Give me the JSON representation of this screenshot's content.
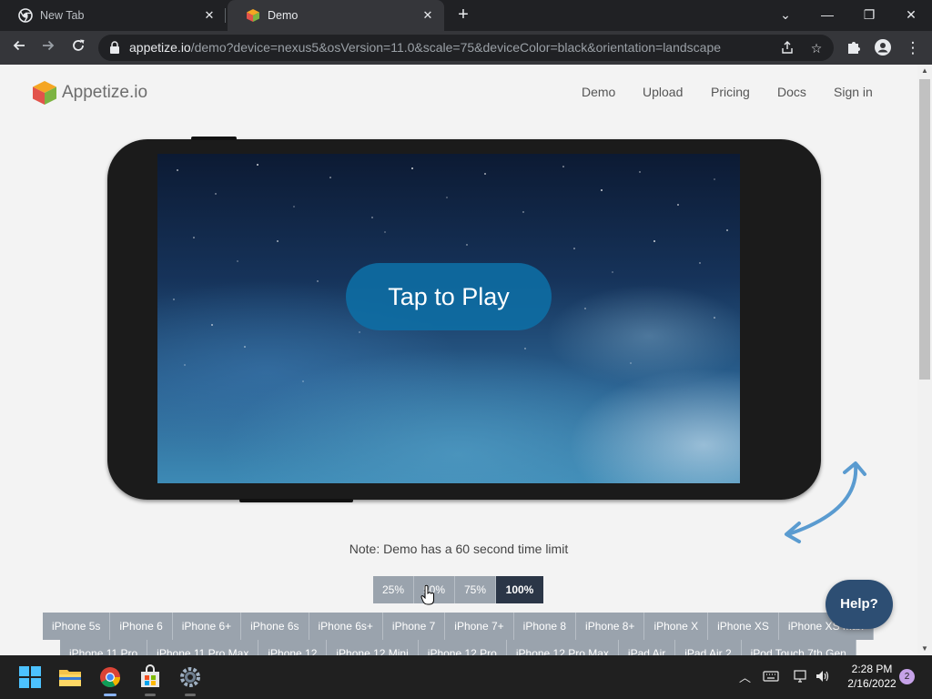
{
  "browser": {
    "tabs": [
      {
        "title": "New Tab"
      },
      {
        "title": "Demo"
      }
    ],
    "url_host": "appetize.io",
    "url_path": "/demo?device=nexus5&osVersion=11.0&scale=75&deviceColor=black&orientation=landscape"
  },
  "site": {
    "logo_text": "Appetize.io",
    "nav": [
      "Demo",
      "Upload",
      "Pricing",
      "Docs",
      "Sign in"
    ]
  },
  "device_screen": {
    "play_label": "Tap to Play"
  },
  "note": "Note: Demo has a 60 second time limit",
  "scale_options": [
    "25%",
    "50%",
    "75%",
    "100%"
  ],
  "scale_selected": "100%",
  "devices_row1": [
    "iPhone 5s",
    "iPhone 6",
    "iPhone 6+",
    "iPhone 6s",
    "iPhone 6s+",
    "iPhone 7",
    "iPhone 7+",
    "iPhone 8",
    "iPhone 8+",
    "iPhone X",
    "iPhone XS",
    "iPhone XS Max"
  ],
  "devices_row2": [
    "iPhone 11 Pro",
    "iPhone 11 Pro Max",
    "iPhone 12",
    "iPhone 12 Mini",
    "iPhone 12 Pro",
    "iPhone 12 Pro Max",
    "iPad Air",
    "iPad Air 2",
    "iPod Touch 7th Gen"
  ],
  "help_label": "Help?",
  "taskbar": {
    "time": "2:28 PM",
    "date": "2/16/2022",
    "notification_count": "2"
  },
  "colors": {
    "scale_selected_bg": "#2b3647",
    "device_button_bg": "#9aa3ad",
    "help_bg": "#2d4e73",
    "play_button_bg": "#0e6ea5"
  }
}
